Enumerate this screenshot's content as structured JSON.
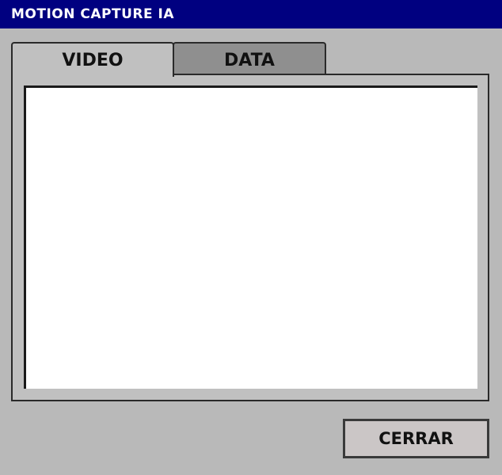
{
  "window": {
    "title": "MOTION CAPTURE IA"
  },
  "tabs": [
    {
      "label": "VIDEO",
      "active": true
    },
    {
      "label": "DATA",
      "active": false
    }
  ],
  "buttons": {
    "close_label": "CERRAR"
  },
  "colors": {
    "titlebar": "#000080",
    "window_bg": "#b9b9b9",
    "active_tab": "#c0c0c0",
    "inactive_tab": "#8f8f8f",
    "video_bg": "#ffffff",
    "button_bg": "#cbc6c6"
  }
}
